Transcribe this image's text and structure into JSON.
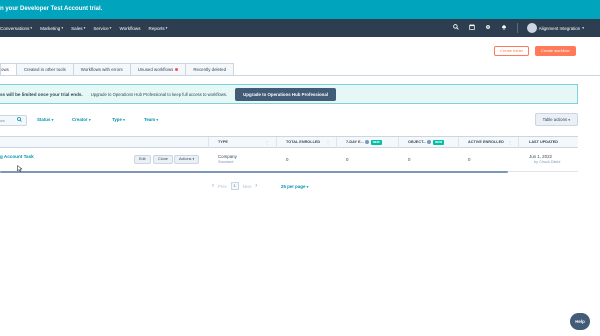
{
  "banner": {
    "text": "n your Developer Test Account trial."
  },
  "nav": {
    "items": [
      {
        "label": "Conversations"
      },
      {
        "label": "Marketing"
      },
      {
        "label": "Sales"
      },
      {
        "label": "Service"
      },
      {
        "label": "Workflows"
      },
      {
        "label": "Reports"
      }
    ],
    "account_name": "Alignment Integration",
    "icons": [
      "search-icon",
      "marketplace-icon",
      "settings-icon",
      "notifications-icon"
    ]
  },
  "header": {
    "create_folder": "Create folder",
    "create_workflow": "Create workflow"
  },
  "tabs": [
    {
      "label": "ows"
    },
    {
      "label": "Created in other tools"
    },
    {
      "label": "Workflows with errors"
    },
    {
      "label": "Unused workflows"
    },
    {
      "label": "Recently deleted"
    }
  ],
  "alert": {
    "bold": "ss will be limited once your trial ends.",
    "text": "Upgrade to Operations Hub Professional to keep full access to workflows.",
    "button": "Upgrade to Operations Hub Professional"
  },
  "filters": {
    "search_placeholder": "ws",
    "status": "Status",
    "creator": "Creator",
    "type": "Type",
    "team": "Team",
    "table_actions": "Table actions"
  },
  "table": {
    "columns": {
      "type": "TYPE",
      "total_enrolled": "TOTAL ENROLLED",
      "seven_day": "7-DAY E...",
      "object": "OBJECT...",
      "new_badge": "NEW",
      "active_enrolled": "ACTIVE ENROLLED",
      "last_updated": "LAST UPDATED"
    },
    "row": {
      "name": "g Account Task",
      "edit": "Edit",
      "clone": "Clone",
      "actions": "Actions",
      "type": "Company",
      "type_sub": "Standard",
      "total_enrolled": "0",
      "seven_day": "0",
      "object": "0",
      "active_enrolled": "0",
      "last_updated": "Jun 1, 2022",
      "last_updated_by": "by Chuck Ditchi"
    }
  },
  "pagination": {
    "prev": "Prev",
    "page": "1",
    "next": "Next",
    "per_page": "25 per page"
  },
  "help": {
    "label": "Help"
  },
  "colors": {
    "banner": "#00a4bd",
    "nav": "#2d3e50",
    "accent": "#ff7a59",
    "link": "#0091ae",
    "new_badge": "#00bda5"
  }
}
